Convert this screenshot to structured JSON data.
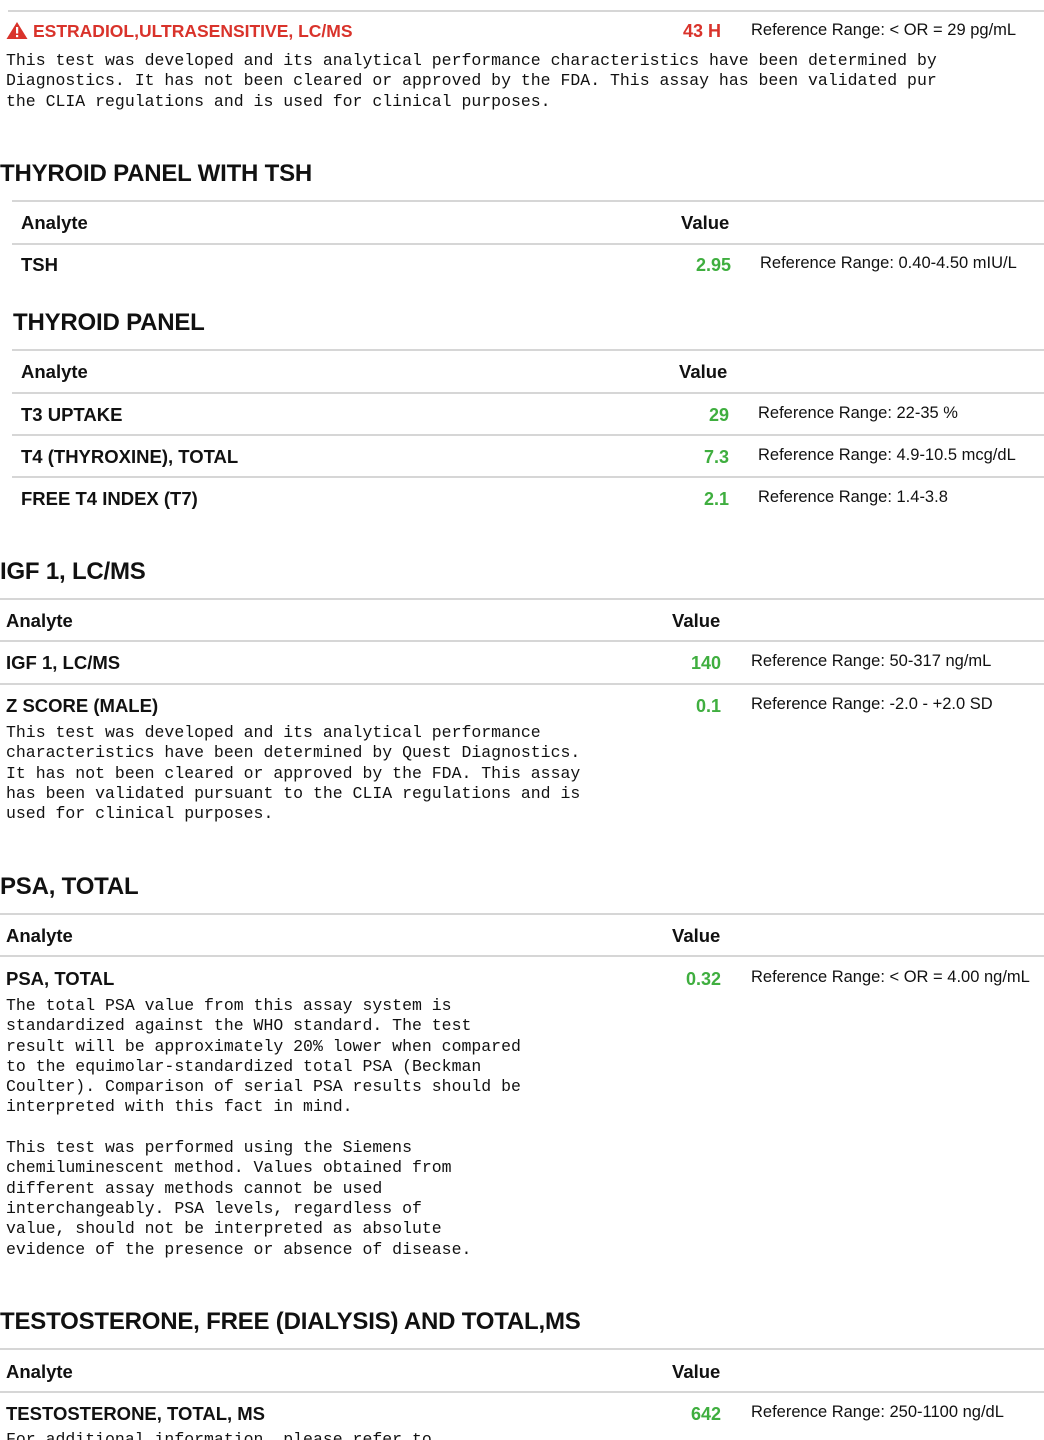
{
  "estradiol": {
    "name": "ESTRADIOL,ULTRASENSITIVE, LC/MS",
    "value": "43 H",
    "reference": "Reference Range: < OR = 29 pg/mL",
    "note": "This test was developed and its analytical performance characteristics have been determined by\nDiagnostics. It has not been cleared or approved by the FDA. This assay has been validated pur\nthe CLIA regulations and is used for clinical purposes.",
    "status_color": "#d9332b",
    "icon": "warning-icon"
  },
  "sections": {
    "thyroid_tsh": {
      "title": "THYROID PANEL WITH TSH",
      "col_analyte": "Analyte",
      "col_value": "Value",
      "rows": [
        {
          "analyte": "TSH",
          "value": "2.95",
          "reference": "Reference Range: 0.40-4.50 mIU/L"
        }
      ]
    },
    "thyroid": {
      "title": "THYROID PANEL",
      "col_analyte": "Analyte",
      "col_value": "Value",
      "rows": [
        {
          "analyte": "T3 UPTAKE",
          "value": "29",
          "reference": "Reference Range: 22-35 %"
        },
        {
          "analyte": "T4 (THYROXINE), TOTAL",
          "value": "7.3",
          "reference": "Reference Range: 4.9-10.5 mcg/dL"
        },
        {
          "analyte": "FREE T4 INDEX (T7)",
          "value": "2.1",
          "reference": "Reference Range: 1.4-3.8"
        }
      ]
    },
    "igf": {
      "title": "IGF 1, LC/MS",
      "col_analyte": "Analyte",
      "col_value": "Value",
      "rows": [
        {
          "analyte": "IGF 1, LC/MS",
          "value": "140",
          "reference": "Reference Range: 50-317 ng/mL"
        },
        {
          "analyte": "Z SCORE (MALE)",
          "value": "0.1",
          "reference": "Reference Range: -2.0 - +2.0  SD",
          "note": "This test was developed and its analytical performance\ncharacteristics have been determined by Quest Diagnostics.\nIt has not been cleared or approved by the FDA. This assay\nhas been validated pursuant to the CLIA regulations and is\nused for clinical purposes."
        }
      ]
    },
    "psa": {
      "title": "PSA, TOTAL",
      "col_analyte": "Analyte",
      "col_value": "Value",
      "rows": [
        {
          "analyte": "PSA, TOTAL",
          "value": "0.32",
          "reference": "Reference Range: < OR = 4.00  ng/mL",
          "note": "The total PSA value from this assay system is\nstandardized against the WHO standard. The test\nresult will be approximately 20% lower when compared\nto the equimolar-standardized total PSA (Beckman\nCoulter). Comparison of serial PSA results should be\ninterpreted with this fact in mind.\n\nThis test was performed using the Siemens\nchemiluminescent method. Values obtained from\ndifferent assay methods cannot be used\ninterchangeably. PSA levels, regardless of\nvalue, should not be interpreted as absolute\nevidence of the presence or absence of disease."
        }
      ]
    },
    "testosterone": {
      "title": "TESTOSTERONE, FREE (DIALYSIS) AND TOTAL,MS",
      "col_analyte": "Analyte",
      "col_value": "Value",
      "rows": [
        {
          "analyte": "TESTOSTERONE, TOTAL, MS",
          "value": "642",
          "reference": "Reference Range: 250-1100 ng/dL",
          "note": "For additional information, please refer to"
        }
      ]
    }
  },
  "normal_color": "#3fae3f"
}
